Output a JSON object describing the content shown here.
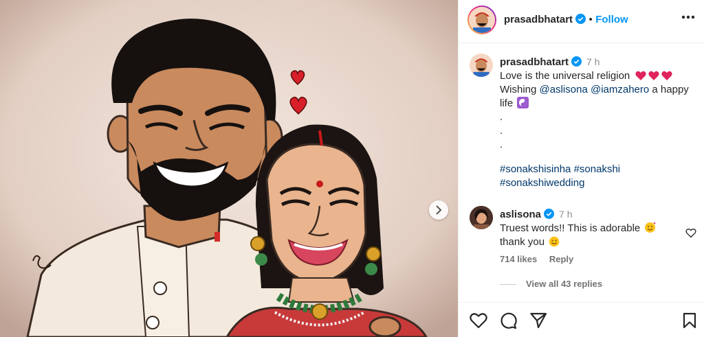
{
  "post": {
    "author": "prasadbhatart",
    "follow_label": "Follow",
    "separator": "•",
    "more_label": "More options",
    "next_label": "Next"
  },
  "caption": {
    "author": "prasadbhatart",
    "time": "7 h",
    "line1": "Love is the universal religion",
    "wishing": "Wishing",
    "mention1": "@aslisona",
    "mention2": "@iamzahero",
    "rest": "a happy life",
    "dots": [
      ".",
      ".",
      "."
    ],
    "hashtags_line1": [
      "#sonakshisinha",
      "#sonakshi"
    ],
    "hashtags_line2": [
      "#sonakshiwedding"
    ]
  },
  "comment": {
    "author": "aslisona",
    "time": "7 h",
    "text_line1": "Truest words!! This is adorable",
    "text_line2": "thank you",
    "likes": "714 likes",
    "reply_label": "Reply",
    "view_replies": "View all 43 replies"
  },
  "colors": {
    "accent": "#0095f6",
    "link": "#00376b",
    "verified": "#0095f6",
    "heart": "#e0245e"
  },
  "icons": [
    "verified-icon",
    "more-icon",
    "heart-emoji-icon",
    "yin-yang-icon",
    "smiling-hearts-emoji-icon",
    "smile-emoji-icon",
    "like-icon",
    "comment-icon",
    "share-icon",
    "save-icon",
    "chevron-right-icon"
  ]
}
